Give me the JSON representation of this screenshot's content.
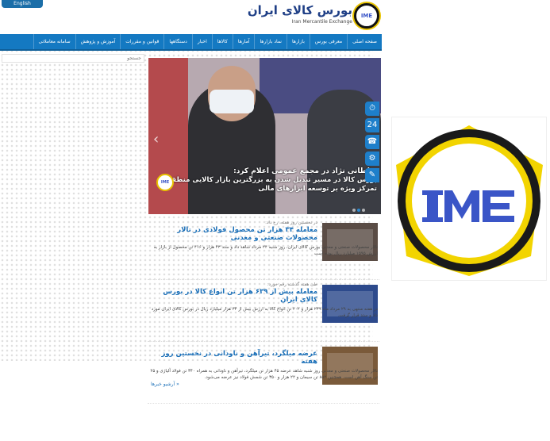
{
  "header": {
    "lang_button": "English",
    "logo_title": "بورس کالای ایران",
    "logo_subtitle": "Iran Mercantile Exchange",
    "emblem_text": "IME"
  },
  "nav": {
    "items": [
      "صفحه اصلی",
      "معرفی بورس",
      "بازارها",
      "نماد بازارها",
      "آمارها",
      "کالاها",
      "اخبار",
      "دستگاهها",
      "قوانین و مقررات",
      "آموزش و پژوهش",
      "سامانه معاملاتی"
    ]
  },
  "search": {
    "placeholder": "جستجو"
  },
  "slider": {
    "caption_line1": "سلطانی نژاد در مجمع عمومی اعلام کرد:",
    "caption_line2": "بورس کالا در مسیر تبدیل شدن به بزرگترین بازار کالایی منطقه/",
    "caption_line3": "تمرکز ویژه بر توسعه ابزارهای مالی",
    "badge": "IME"
  },
  "news": {
    "items": [
      {
        "date": "در نخستین روز هفته، رخ داد:",
        "title": "معامله ۳۴ هزار تن محصول فولادی در تالار محصولات صنعتی و معدنی",
        "body": "تالار محصولات صنعتی و معدنی بورس کالای ایران، روز شنبه ۲۴ مرداد شاهد داد و ستد ۴۳ هزار و ۴۱۶ تن محصول از بازار به ارزش ۱۵۹۵ میلیارد ریال بوده است"
      },
      {
        "date": "طی هفته گذشته رقم خورد:",
        "title": "معامله بیش از ۶۳۹ هزار تن انواع کالا در بورس کالای ایران",
        "body": "در هفته منتهی به ۲۹ مرداد ماه ۲۳۹ هزار و ۲۰۲ تن انواع کالا به ارزش بیش از ۳۴ هزار میلیارد ریال در بورس کالای ایران مورد داد و ستد قرار گرفت."
      },
      {
        "date": "",
        "title": "عرضه میلگرد، تیرآهن و ناودانی در نخستین روز هفته",
        "body": "تالار محصولات صنعتی و معدنی روز شنبه شاهد عرضه ۴۵ هزار تن میلگرد، تیرآهن و ناودانی به همراه ۳۴۰ تن فولاد آلیاژی و ۲۵ تن سنگ آهن است. همچنین ۸۵۲ تن سیمان و ۲۲ هزار و ۳۵۰ تن شمش فولاد نیز عرضه می‌شود."
      }
    ],
    "archive_label": "« آرشیو خبرها"
  },
  "quicklinks": [
    "⏱",
    "24",
    "☎",
    "⚙",
    "✎"
  ],
  "colors": {
    "nav_blue": "#1479c2",
    "title_blue": "#1a6fb8",
    "logo_yellow": "#f2d400",
    "logo_blue": "#3a55c7"
  }
}
